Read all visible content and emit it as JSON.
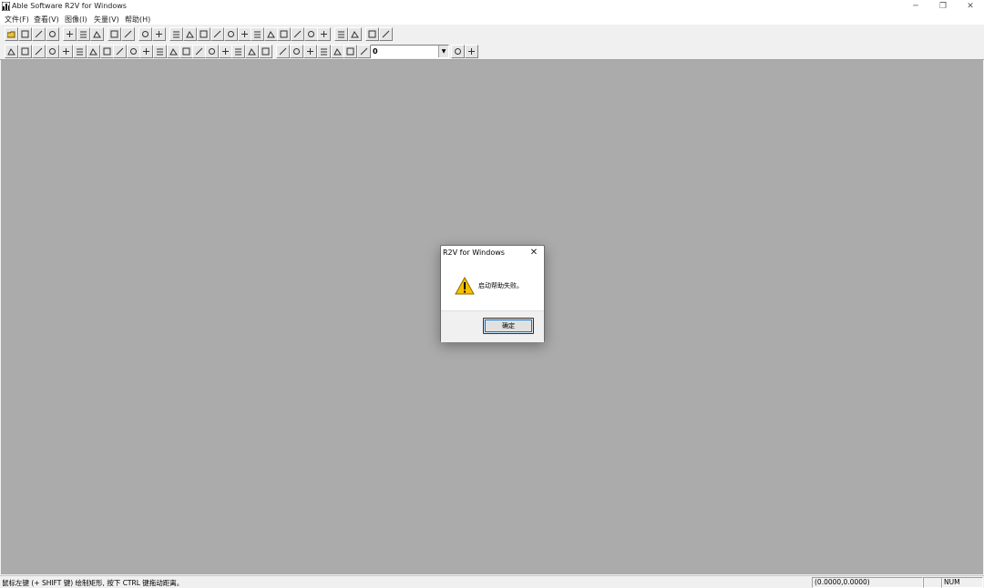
{
  "window": {
    "title": "Able Software R2V for Windows",
    "controls": {
      "minimize": "─",
      "restore": "❐",
      "close": "✕"
    }
  },
  "menu": {
    "items": [
      "文件(F)",
      "查看(V)",
      "图像(I)",
      "矢量(V)",
      "帮助(H)"
    ]
  },
  "toolbar": {
    "layer_value": "0",
    "icons_row1": [
      "open-icon",
      "save-icon",
      "save-image-icon",
      "save-vector-icon",
      "zoom-in-icon",
      "zoom-out-icon",
      "zoom-fit-icon",
      "undo-icon",
      "pointer-icon",
      "scan-icon",
      "calibrate-icon",
      "select-window-icon",
      "select-all-icon",
      "crop-icon",
      "spread-horizontal-icon",
      "spread-left-icon",
      "threshold-icon",
      "add-node-icon",
      "move-down-icon",
      "center-icon",
      "table-icon",
      "grid-icon",
      "crosshair-icon",
      "find-icon",
      "label-icon",
      "help-icon",
      "context-help-icon"
    ],
    "icons_row2": [
      "text-icon",
      "line-icon",
      "curve-icon",
      "split-icon",
      "vertical-icon",
      "horizontal-icon",
      "join-icon",
      "smooth-icon",
      "dot-icon",
      "node-icon",
      "box-icon",
      "diagonal-icon",
      "dash-icon",
      "node-move-icon",
      "snap-icon",
      "filter-icon",
      "square-icon",
      "tool-icon",
      "fill-icon",
      "digitize-icon",
      "trace-icon",
      "link-icon",
      "break-icon",
      "scatter-icon",
      "chart-icon",
      "edit-icon",
      "vertex-icon",
      "layer-visible-icon",
      "layer-props-icon"
    ]
  },
  "dialog": {
    "title": "R2V for Windows",
    "message": "启动帮助失败。",
    "ok_label": "确定",
    "close": "✕"
  },
  "statusbar": {
    "hint": "鼠标左键 (+ SHIFT 键) 绘制矩形, 按下 CTRL 键拖动距离。",
    "coords": "(0.0000,0.0000)",
    "num": "NUM"
  },
  "colors": {
    "workspace": "#ababab",
    "warning": "#f5c000",
    "focus": "#0078d7"
  }
}
